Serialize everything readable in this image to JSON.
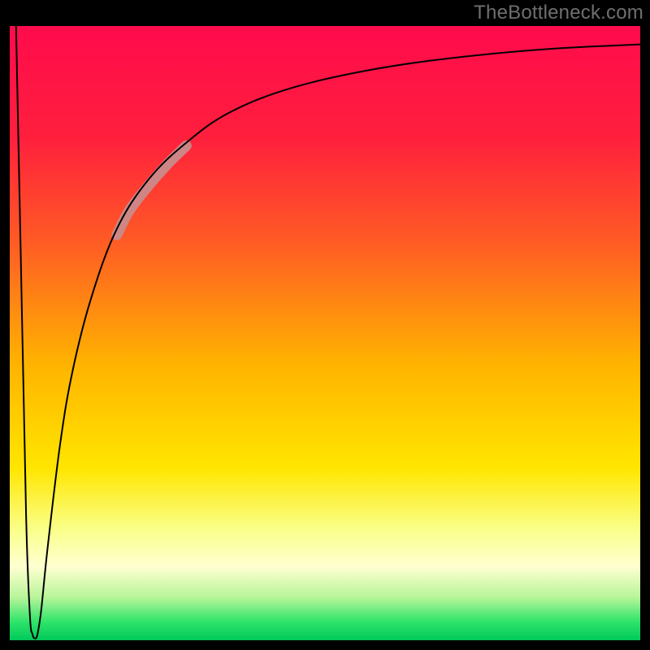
{
  "watermark": "TheBottleneck.com",
  "chart_data": {
    "type": "line",
    "title": "",
    "xlabel": "",
    "ylabel": "",
    "xlim": [
      0,
      100
    ],
    "ylim": [
      0,
      100
    ],
    "grid": false,
    "legend": false,
    "gradient_stops": [
      {
        "offset": 0.0,
        "color": "#ff0b4d"
      },
      {
        "offset": 0.18,
        "color": "#ff1f3d"
      },
      {
        "offset": 0.35,
        "color": "#ff5a25"
      },
      {
        "offset": 0.55,
        "color": "#ffb300"
      },
      {
        "offset": 0.72,
        "color": "#ffe600"
      },
      {
        "offset": 0.82,
        "color": "#faff8a"
      },
      {
        "offset": 0.88,
        "color": "#ffffd0"
      },
      {
        "offset": 0.93,
        "color": "#b8f59a"
      },
      {
        "offset": 0.97,
        "color": "#2fe46a"
      },
      {
        "offset": 1.0,
        "color": "#00c95a"
      }
    ],
    "series": [
      {
        "name": "curve",
        "color": "#000000",
        "width": 2,
        "points": [
          {
            "x": 1.0,
            "y": 100.0
          },
          {
            "x": 1.8,
            "y": 60.0
          },
          {
            "x": 2.6,
            "y": 20.0
          },
          {
            "x": 3.2,
            "y": 4.0
          },
          {
            "x": 3.6,
            "y": 1.0
          },
          {
            "x": 4.0,
            "y": 0.3
          },
          {
            "x": 4.4,
            "y": 1.0
          },
          {
            "x": 5.0,
            "y": 5.0
          },
          {
            "x": 6.0,
            "y": 15.0
          },
          {
            "x": 8.0,
            "y": 32.0
          },
          {
            "x": 10.0,
            "y": 44.0
          },
          {
            "x": 13.0,
            "y": 56.0
          },
          {
            "x": 17.0,
            "y": 67.0
          },
          {
            "x": 22.0,
            "y": 75.0
          },
          {
            "x": 28.0,
            "y": 81.0
          },
          {
            "x": 35.0,
            "y": 86.0
          },
          {
            "x": 45.0,
            "y": 90.0
          },
          {
            "x": 58.0,
            "y": 93.0
          },
          {
            "x": 72.0,
            "y": 95.0
          },
          {
            "x": 86.0,
            "y": 96.3
          },
          {
            "x": 100.0,
            "y": 97.0
          }
        ]
      },
      {
        "name": "highlight",
        "color": "#ca8a8a",
        "width": 13,
        "linecap": "round",
        "points": [
          {
            "x": 17.0,
            "y": 66.0
          },
          {
            "x": 19.0,
            "y": 70.0
          },
          {
            "x": 22.0,
            "y": 74.0
          },
          {
            "x": 25.0,
            "y": 77.5
          },
          {
            "x": 28.0,
            "y": 80.5
          }
        ]
      }
    ]
  }
}
